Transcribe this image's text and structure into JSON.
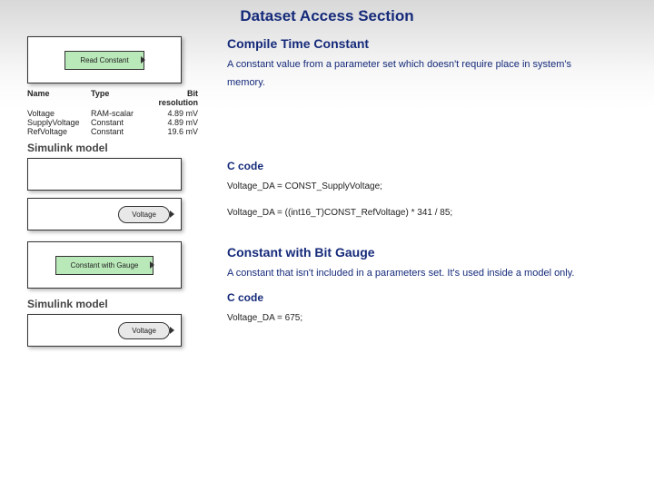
{
  "page": {
    "title": "Dataset Access Section"
  },
  "section1": {
    "title": "Compile Time Constant",
    "desc": "A constant value from a parameter set which doesn't require place in system's memory.",
    "block_label": "Read Constant",
    "simulink_label": "Simulink model",
    "ccode_label": "C code",
    "voltage_label": "Voltage",
    "code1": "Voltage_DA = CONST_SupplyVoltage;",
    "code2": "Voltage_DA = ((int16_T)CONST_RefVoltage) * 341 / 85;"
  },
  "table": {
    "headers": {
      "name": "Name",
      "type": "Type",
      "bitres": "Bit resolution"
    },
    "rows": [
      {
        "name": "Voltage",
        "type": "RAM-scalar",
        "bitres": "4.89 mV"
      },
      {
        "name": "SupplyVoltage",
        "type": "Constant",
        "bitres": "4.89 mV"
      },
      {
        "name": "RefVoltage",
        "type": "Constant",
        "bitres": "19.6 mV"
      }
    ]
  },
  "section2": {
    "title": "Constant with Bit Gauge",
    "desc": "A constant that isn't included in a parameters set. It's used inside a model only.",
    "block_label": "Constant with Gauge",
    "simulink_label": "Simulink model",
    "ccode_label": "C code",
    "voltage_label": "Voltage",
    "code1": "Voltage_DA = 675;"
  }
}
